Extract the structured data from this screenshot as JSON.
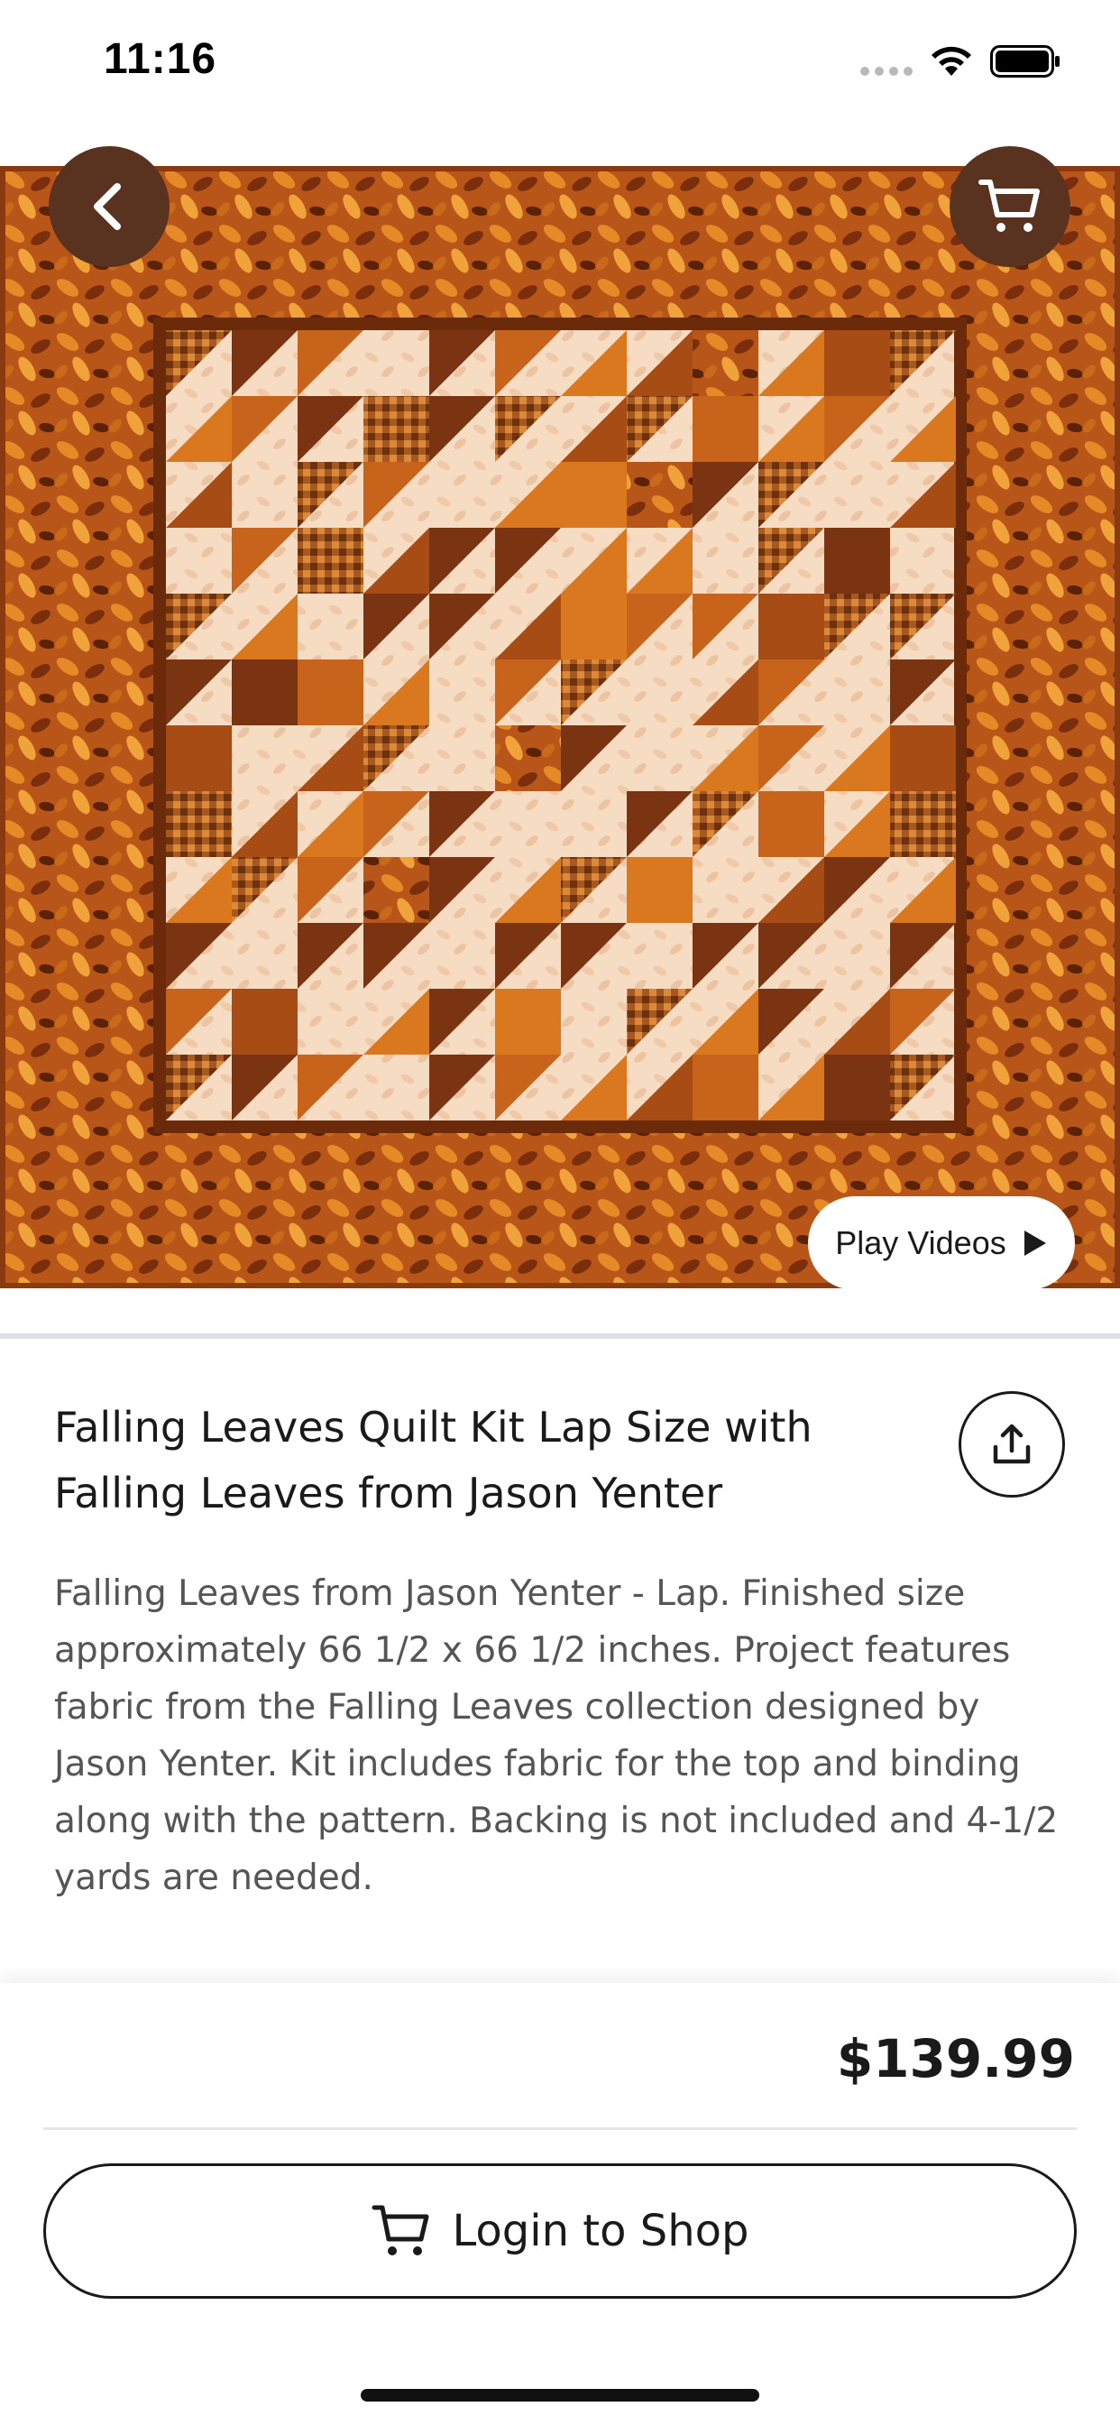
{
  "status_bar": {
    "time": "11:16"
  },
  "hero": {
    "image_name": "falling-leaves-quilt-image",
    "page_count": 2,
    "active_page": 2,
    "play_videos_label": "Play Videos"
  },
  "product": {
    "title_line1": "Falling Leaves Quilt Kit Lap Size with",
    "title_line2": "Falling Leaves from Jason Yenter",
    "description": "Falling Leaves from Jason Yenter - Lap. Finished size approximately 66 1/2 x 66 1/2 inches. Project features fabric from the Falling Leaves collection designed by Jason Yenter. Kit includes fabric for the top and binding along with the pattern. Backing is not included and 4-1/2 yards are needed."
  },
  "purchase": {
    "price": "$139.99",
    "login_label": "Login to Shop"
  },
  "colors": {
    "nav_button_bg": "#5a3320",
    "text_primary": "#1a1a1a",
    "text_secondary": "#555555",
    "quilt_border": "#8a3a10",
    "quilt_light": "#f4d9bf",
    "quilt_orange": "#d9781f",
    "quilt_brown": "#7a3412"
  },
  "icons": [
    "back-chevron-icon",
    "cart-icon",
    "play-icon",
    "share-icon",
    "wifi-icon",
    "battery-icon"
  ]
}
